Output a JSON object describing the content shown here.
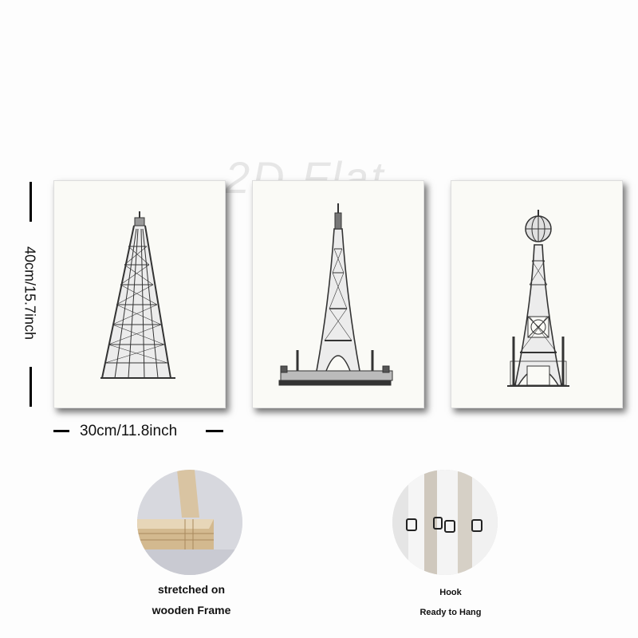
{
  "watermark": "2D Flat",
  "dimensions": {
    "height_label": "40cm/15.7inch",
    "width_label": "30cm/11.8inch"
  },
  "panels": [
    {
      "name": "tower-print-1"
    },
    {
      "name": "tower-print-2"
    },
    {
      "name": "tower-print-3"
    }
  ],
  "features": {
    "frame": {
      "line1": "stretched on",
      "line2": "wooden Frame"
    },
    "hook": {
      "line1": "Hook",
      "line2": "Ready to Hang"
    }
  }
}
